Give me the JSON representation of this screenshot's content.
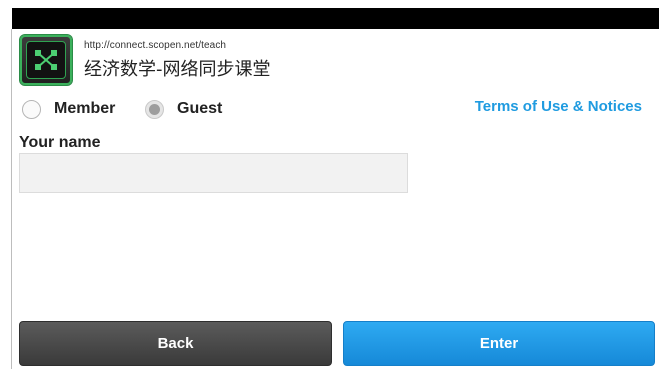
{
  "meeting": {
    "url": "http://connect.scopen.net/teach",
    "name": "经济数学-网络同步课堂"
  },
  "login": {
    "options": [
      {
        "label": "Member",
        "selected": false
      },
      {
        "label": "Guest",
        "selected": true
      }
    ],
    "terms_link": "Terms of Use & Notices",
    "name_label": "Your name",
    "name_value": "",
    "name_placeholder": ""
  },
  "buttons": {
    "back": "Back",
    "enter": "Enter"
  },
  "icons": {
    "app": "adobe-connect-app-icon"
  },
  "colors": {
    "link": "#1f9be0",
    "enter_button": "#1e95e4",
    "back_button": "#484848",
    "app_icon_accent": "#3bb15c"
  }
}
